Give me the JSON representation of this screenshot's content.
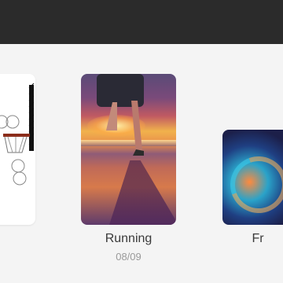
{
  "carousel": {
    "items": [
      {
        "title": "",
        "date": ""
      },
      {
        "title": "Running",
        "date": "08/09"
      },
      {
        "title": "Fr",
        "date": ""
      }
    ]
  },
  "colors": {
    "topbar": "#2b2b2b",
    "background": "#f4f4f4",
    "title_text": "#3a3a3a",
    "date_text": "#9a9a9a"
  }
}
